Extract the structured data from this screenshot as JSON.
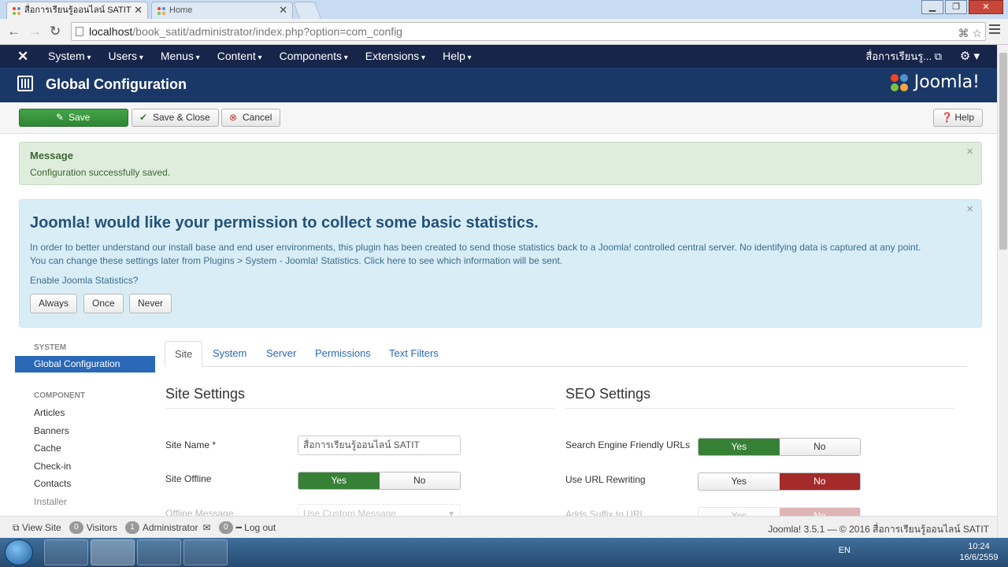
{
  "browser": {
    "tabs": [
      {
        "label": "สื่อการเรียนรู้ออนไลน์ SATIT",
        "active": true
      },
      {
        "label": "Home",
        "active": false
      }
    ],
    "url_host": "localhost",
    "url_path": "/book_satit/administrator/index.php?option=com_config"
  },
  "nav": {
    "items": [
      "System",
      "Users",
      "Menus",
      "Content",
      "Components",
      "Extensions",
      "Help"
    ],
    "user": "สื่อการเรียนรู..."
  },
  "header": {
    "title": "Global Configuration",
    "brand": "Joomla!"
  },
  "toolbar": {
    "save": "Save",
    "save_close": "Save & Close",
    "cancel": "Cancel",
    "help": "Help"
  },
  "message": {
    "heading": "Message",
    "text": "Configuration successfully saved."
  },
  "stats": {
    "heading": "Joomla! would like your permission to collect some basic statistics.",
    "line1": "In order to better understand our install base and end user environments, this plugin has been created to send those statistics back to a Joomla! controlled central server. No identifying data is captured at any point.",
    "line2": "You can change these settings later from Plugins > System - Joomla! Statistics. Click here to see which information will be sent.",
    "question": "Enable Joomla Statistics?",
    "buttons": [
      "Always",
      "Once",
      "Never"
    ]
  },
  "sidebar": {
    "system_header": "SYSTEM",
    "system_items": [
      "Global Configuration"
    ],
    "component_header": "COMPONENT",
    "component_items": [
      "Articles",
      "Banners",
      "Cache",
      "Check-in",
      "Contacts",
      "Installer"
    ]
  },
  "tabs": [
    "Site",
    "System",
    "Server",
    "Permissions",
    "Text Filters"
  ],
  "site_settings": {
    "title": "Site Settings",
    "site_name_label": "Site Name *",
    "site_name_value": "สื่อการเรียนรู้ออนไลน์ SATIT",
    "site_offline_label": "Site Offline",
    "offline_message_label": "Offline Message",
    "offline_message_value": "Use Custom Message"
  },
  "seo_settings": {
    "title": "SEO Settings",
    "sef_label": "Search Engine Friendly URLs",
    "rewrite_label": "Use URL Rewriting",
    "suffix_label": "Adds Suffix to URL"
  },
  "switch": {
    "yes": "Yes",
    "no": "No"
  },
  "status": {
    "view_site": "View Site",
    "visitors_count": "0",
    "visitors": "Visitors",
    "admin_count": "1",
    "administrator": "Administrator",
    "msg_count": "0",
    "logout": "Log out",
    "footer": "Joomla! 3.5.1 — © 2016 สื่อการเรียนรู้ออนไลน์ SATIT"
  },
  "taskbar": {
    "lang": "EN",
    "time": "10:24",
    "date": "16/6/2559"
  },
  "colors": {
    "nav_bg": "#17254a",
    "header_bg": "#1a3867",
    "save_green": "#378137",
    "no_red": "#a42b2a",
    "active_blue": "#2a69b8"
  }
}
